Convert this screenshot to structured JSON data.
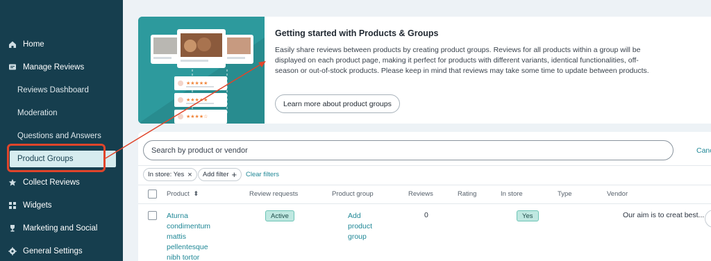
{
  "sidebar": {
    "items": [
      {
        "label": "Home",
        "icon": "home-icon"
      },
      {
        "label": "Manage Reviews",
        "icon": "reviews-icon"
      },
      {
        "label": "Reviews Dashboard"
      },
      {
        "label": "Moderation"
      },
      {
        "label": "Questions and Answers"
      },
      {
        "label": "Product Groups"
      },
      {
        "label": "Collect Reviews",
        "icon": "star-icon"
      },
      {
        "label": "Widgets",
        "icon": "widgets-icon"
      },
      {
        "label": "Marketing and Social",
        "icon": "trophy-icon"
      },
      {
        "label": "General Settings",
        "icon": "gear-icon"
      }
    ]
  },
  "banner": {
    "title": "Getting started with Products & Groups",
    "body": "Easily share reviews between products by creating product groups. Reviews for all products within a group will be displayed on each product page, making it perfect for products with different variants, identical functionalities, off-season or out-of-stock products. Please keep in mind that reviews may take some time to update between products.",
    "button_label": "Learn more about product groups"
  },
  "search": {
    "placeholder": "Search by product or vendor",
    "cancel_label": "Canc"
  },
  "filters": {
    "chip_label": "In store: Yes",
    "chip_close": "×",
    "add_filter_label": "Add filter",
    "add_icon": "+",
    "clear_label": "Clear filters"
  },
  "table": {
    "columns": [
      "Product",
      "Review requests",
      "Product group",
      "Reviews",
      "Rating",
      "In store",
      "Type",
      "Vendor"
    ],
    "sort_icon": "⬍",
    "rows": [
      {
        "product": "Aturna condimentum mattis pellentesque nibh tortor",
        "review_requests": "Active",
        "product_group": "Add product group",
        "reviews": "0",
        "rating": "",
        "in_store": "Yes",
        "type": "",
        "vendor": "Our aim is to creat best...",
        "more": "•••"
      }
    ]
  },
  "colors": {
    "sidebar_bg": "#163e4e",
    "accent": "#1f8796",
    "callout": "#e0452b",
    "illustration": "#2d9a9d"
  }
}
